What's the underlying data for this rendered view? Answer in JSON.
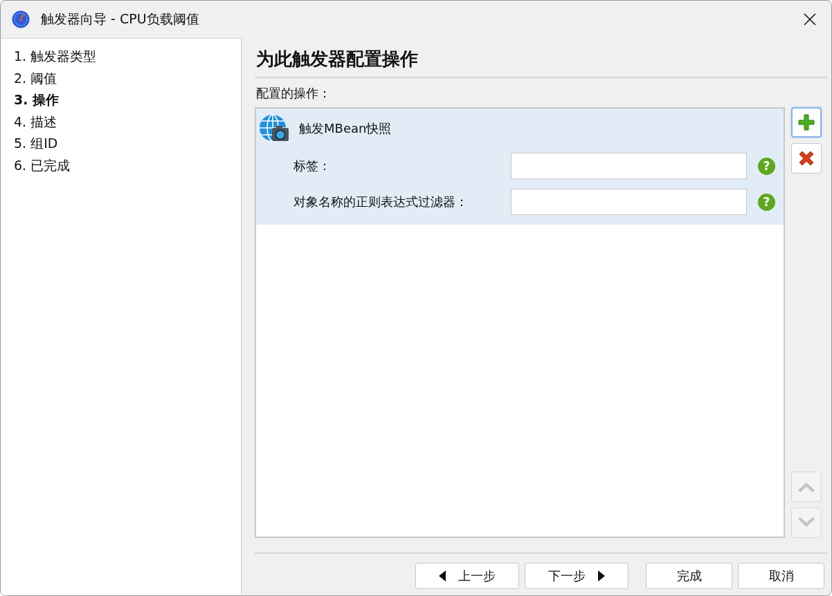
{
  "window": {
    "title": "触发器向导 - CPU负载阈值"
  },
  "steps": [
    {
      "label": "1. 触发器类型",
      "selected": false
    },
    {
      "label": "2. 阈值",
      "selected": false
    },
    {
      "label": "3. 操作",
      "selected": true
    },
    {
      "label": "4. 描述",
      "selected": false
    },
    {
      "label": "5. 组ID",
      "selected": false
    },
    {
      "label": "6. 已完成",
      "selected": false
    }
  ],
  "page": {
    "heading": "为此触发器配置操作",
    "list_label": "配置的操作："
  },
  "actions": [
    {
      "title": "触发MBean快照",
      "selected": true,
      "fields": [
        {
          "label": "标签：",
          "help": "?"
        },
        {
          "label": "对象名称的正则表达式过滤器：",
          "help": "?"
        }
      ]
    }
  ],
  "side_buttons": [
    {
      "kind": "add",
      "disabled": false,
      "focused": true
    },
    {
      "kind": "remove",
      "disabled": false,
      "focused": false
    },
    {
      "kind": "up",
      "disabled": true,
      "focused": false
    },
    {
      "kind": "down",
      "disabled": true,
      "focused": false
    }
  ],
  "nav_buttons": [
    {
      "label": "上一步",
      "kind": "back"
    },
    {
      "label": "下一步",
      "kind": "next"
    },
    {
      "label": "完成",
      "kind": "plain"
    },
    {
      "label": "取消",
      "kind": "plain"
    }
  ]
}
